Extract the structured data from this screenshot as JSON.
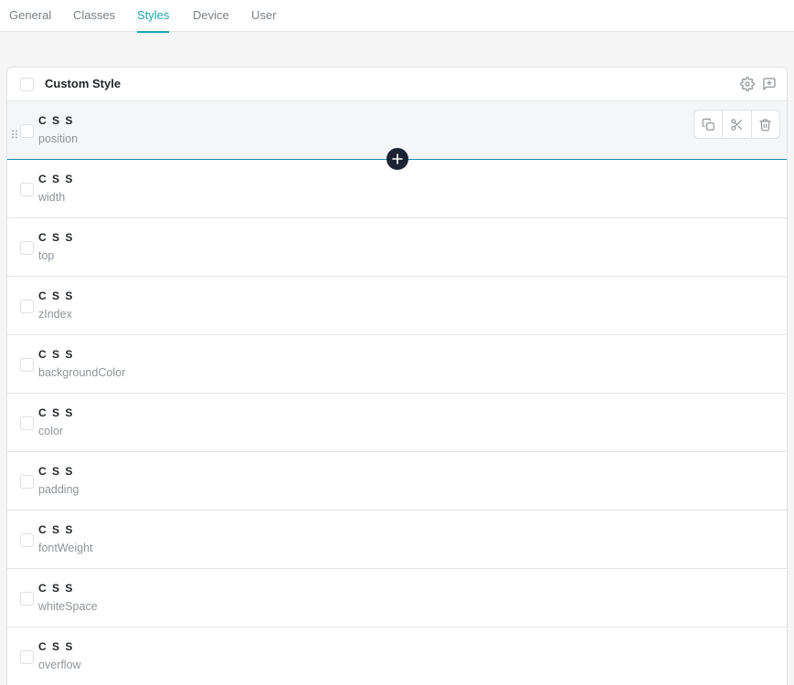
{
  "tabs": [
    {
      "label": "General"
    },
    {
      "label": "Classes"
    },
    {
      "label": "Styles"
    },
    {
      "label": "Device"
    },
    {
      "label": "User"
    }
  ],
  "active_tab": "Styles",
  "accent_color": "#1aa5b0",
  "panel": {
    "title": "Custom Style",
    "header_icons": [
      "gear-icon",
      "add-comment-icon"
    ]
  },
  "row_actions": [
    "copy-icon",
    "scissors-icon",
    "trash-icon"
  ],
  "rows": [
    {
      "label": "C S S",
      "value": "position"
    },
    {
      "label": "C S S",
      "value": "width"
    },
    {
      "label": "C S S",
      "value": "top"
    },
    {
      "label": "C S S",
      "value": "zIndex"
    },
    {
      "label": "C S S",
      "value": "backgroundColor"
    },
    {
      "label": "C S S",
      "value": "color"
    },
    {
      "label": "C S S",
      "value": "padding"
    },
    {
      "label": "C S S",
      "value": "fontWeight"
    },
    {
      "label": "C S S",
      "value": "whiteSpace"
    },
    {
      "label": "C S S",
      "value": "overflow"
    }
  ]
}
